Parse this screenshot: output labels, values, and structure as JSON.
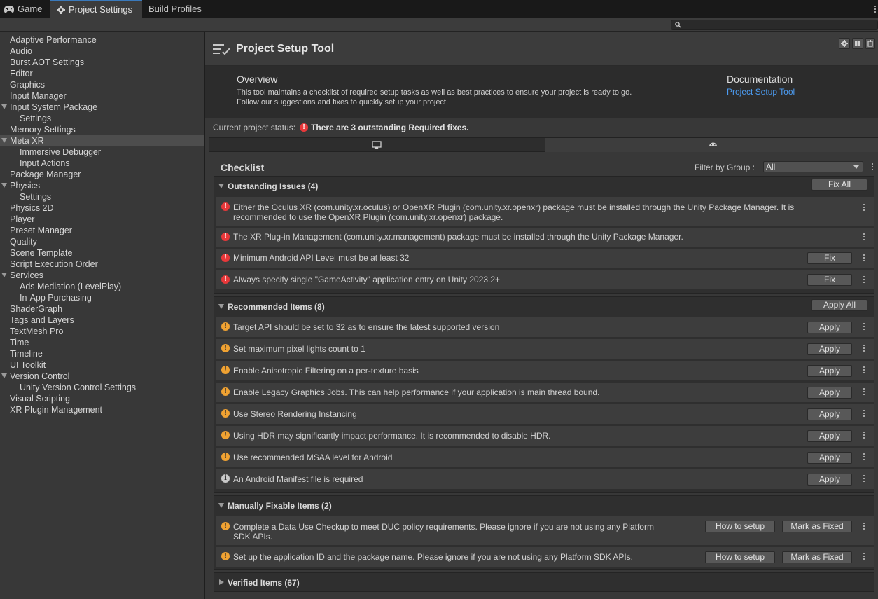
{
  "tabs": [
    {
      "label": "Game",
      "icon": "gamepad-icon"
    },
    {
      "label": "Project Settings",
      "icon": "gear-icon"
    },
    {
      "label": "Build Profiles"
    }
  ],
  "search": {
    "placeholder": "",
    "icon": "search-icon"
  },
  "sidebar": {
    "items": [
      {
        "label": "Adaptive Performance"
      },
      {
        "label": "Audio"
      },
      {
        "label": "Burst AOT Settings"
      },
      {
        "label": "Editor"
      },
      {
        "label": "Graphics"
      },
      {
        "label": "Input Manager"
      },
      {
        "label": "Input System Package"
      },
      {
        "label": "Settings"
      },
      {
        "label": "Memory Settings"
      },
      {
        "label": "Meta XR"
      },
      {
        "label": "Immersive Debugger"
      },
      {
        "label": "Input Actions"
      },
      {
        "label": "Package Manager"
      },
      {
        "label": "Physics"
      },
      {
        "label": "Settings"
      },
      {
        "label": "Physics 2D"
      },
      {
        "label": "Player"
      },
      {
        "label": "Preset Manager"
      },
      {
        "label": "Quality"
      },
      {
        "label": "Scene Template"
      },
      {
        "label": "Script Execution Order"
      },
      {
        "label": "Services"
      },
      {
        "label": "Ads Mediation (LevelPlay)"
      },
      {
        "label": "In-App Purchasing"
      },
      {
        "label": "ShaderGraph"
      },
      {
        "label": "Tags and Layers"
      },
      {
        "label": "TextMesh Pro"
      },
      {
        "label": "Time"
      },
      {
        "label": "Timeline"
      },
      {
        "label": "UI Toolkit"
      },
      {
        "label": "Version Control"
      },
      {
        "label": "Unity Version Control Settings"
      },
      {
        "label": "Visual Scripting"
      },
      {
        "label": "XR Plugin Management"
      }
    ]
  },
  "header": {
    "title": "Project Setup Tool"
  },
  "overview": {
    "title": "Overview",
    "line1": "This tool maintains a checklist of required setup tasks as well as best practices to ensure your project is ready to go.",
    "line2": "Follow our suggestions and fixes to quickly setup your project.",
    "doc_title": "Documentation",
    "doc_link": "Project Setup Tool"
  },
  "status": {
    "label": "Current project status:",
    "message": "There are 3 outstanding Required fixes."
  },
  "checklist": {
    "title": "Checklist",
    "filter_label": "Filter by Group :",
    "filter_value": "All"
  },
  "groups": {
    "outstanding": {
      "title": "Outstanding Issues (4)",
      "action": "Fix All",
      "items": [
        {
          "line1": "Either the Oculus XR (com.unity.xr.oculus) or OpenXR Plugin (com.unity.xr.openxr) package must be installed through the Unity Package Manager. It is",
          "line2": "recommended to use the OpenXR Plugin (com.unity.xr.openxr) package.",
          "severity": "error"
        },
        {
          "line1": "The XR Plug-in Management (com.unity.xr.management) package must be installed through the Unity Package Manager.",
          "severity": "error"
        },
        {
          "line1": "Minimum Android API Level must be at least 32",
          "button": "Fix",
          "severity": "error"
        },
        {
          "line1": "Always specify single \"GameActivity\" application entry on Unity 2023.2+",
          "button": "Fix",
          "severity": "error"
        }
      ]
    },
    "recommended": {
      "title": "Recommended Items (8)",
      "action": "Apply All",
      "items": [
        {
          "line1": "Target API should be set to 32 as to ensure the latest supported version",
          "button": "Apply",
          "severity": "warning"
        },
        {
          "line1": "Set maximum pixel lights count to 1",
          "button": "Apply",
          "severity": "warning"
        },
        {
          "line1": "Enable Anisotropic Filtering on a per-texture basis",
          "button": "Apply",
          "severity": "warning"
        },
        {
          "line1": "Enable Legacy Graphics Jobs. This can help performance if your application is main thread bound.",
          "button": "Apply",
          "severity": "warning"
        },
        {
          "line1": "Use Stereo Rendering Instancing",
          "button": "Apply",
          "severity": "warning"
        },
        {
          "line1": "Using HDR may significantly impact performance. It is recommended to disable HDR.",
          "button": "Apply",
          "severity": "warning"
        },
        {
          "line1": "Use recommended MSAA level for Android",
          "button": "Apply",
          "severity": "warning"
        },
        {
          "line1": "An Android Manifest file is required",
          "button": "Apply",
          "severity": "info"
        }
      ]
    },
    "manual": {
      "title": "Manually Fixable Items (2)",
      "items": [
        {
          "line1": "Complete a Data Use Checkup to meet DUC policy requirements. Please ignore if you are not using any Platform",
          "line2": "SDK APIs.",
          "button1": "How to setup",
          "button2": "Mark as Fixed",
          "severity": "warning"
        },
        {
          "line1": "Set up the application ID and the package name. Please ignore if you are not using any Platform SDK APIs.",
          "button1": "How to setup",
          "button2": "Mark as Fixed",
          "severity": "warning"
        }
      ]
    },
    "verified": {
      "title": "Verified Items (67)"
    }
  },
  "colors": {
    "accent_link": "#4c9cf2",
    "error": "#e8383a",
    "warning": "#f0a232",
    "info": "#c8c8c8"
  },
  "icons": [
    "gamepad-icon",
    "gear-icon",
    "search-icon",
    "checklist-icon",
    "desktop-icon",
    "android-icon",
    "kebab-menu-icon",
    "error-icon",
    "warning-icon",
    "info-icon"
  ]
}
